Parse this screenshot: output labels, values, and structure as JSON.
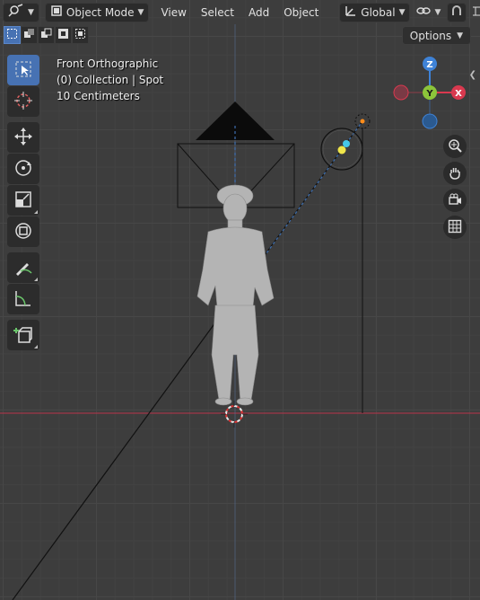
{
  "header": {
    "mode_selector": {
      "label": "Object Mode"
    },
    "menus": [
      "View",
      "Select",
      "Add",
      "Object"
    ],
    "transform_orientation": {
      "label": "Global"
    }
  },
  "toolbar_top": {
    "options_label": "Options"
  },
  "overlay": {
    "view_name": "Front Orthographic",
    "collection_info": "(0) Collection | Spot",
    "grid_scale": "10 Centimeters"
  },
  "gizmo": {
    "z_label": "Z",
    "y_label": "Y",
    "x_label": "X"
  },
  "tools": [
    {
      "name": "select-box-tool",
      "icon": "select-box-icon",
      "active": true
    },
    {
      "name": "cursor-tool",
      "icon": "cursor-icon",
      "active": false
    },
    {
      "name": "move-tool",
      "icon": "move-icon",
      "active": false
    },
    {
      "name": "rotate-tool",
      "icon": "rotate-icon",
      "active": false
    },
    {
      "name": "scale-tool",
      "icon": "scale-icon",
      "active": false
    },
    {
      "name": "transform-tool",
      "icon": "transform-icon",
      "active": false
    },
    {
      "name": "annotate-tool",
      "icon": "annotate-icon",
      "active": false
    },
    {
      "name": "measure-tool",
      "icon": "measure-icon",
      "active": false
    },
    {
      "name": "add-cube-tool",
      "icon": "add-cube-icon",
      "active": false
    }
  ],
  "colors": {
    "accent": "#4772b3",
    "x_axis": "#d9394f",
    "y_axis": "#8cc43a",
    "z_axis": "#3e82d6",
    "background": "#3d3d3d"
  }
}
